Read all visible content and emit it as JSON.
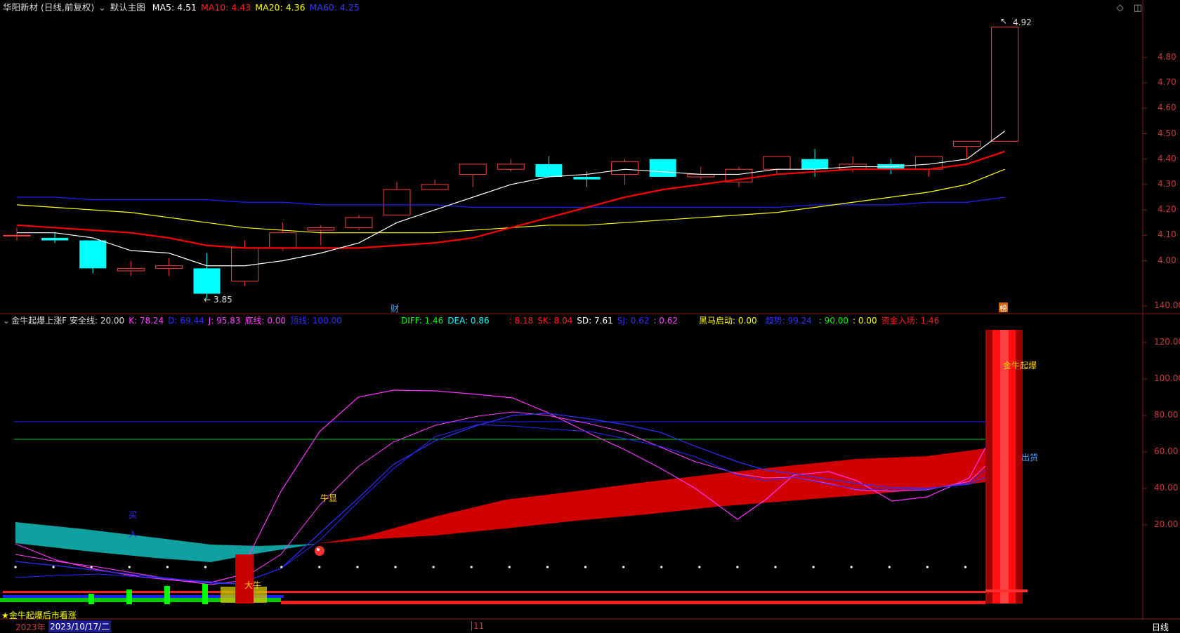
{
  "main_header": {
    "title": "华阳新材 (日线,前复权)",
    "template": "默认主图",
    "ma5": "MA5: 4.51",
    "ma10": "MA10: 4.43",
    "ma20": "MA20: 4.36",
    "ma60": "MA60: 4.25"
  },
  "main_axis": [
    "4.80",
    "4.70",
    "4.60",
    "4.50",
    "4.40",
    "4.30",
    "4.20",
    "4.10",
    "4.00"
  ],
  "main_annotations": {
    "high": "4.92",
    "low": "3.85",
    "cai": "财",
    "badge": "榜"
  },
  "sub_header": {
    "name": "金牛起爆上涨F",
    "safe": "安全线: 20.00",
    "k": "K: 78.24",
    "d": "D: 69.44",
    "j": "J: 95.83",
    "bottom": "底线: 0.00",
    "top": "顶线: 100.00",
    "diff": "DIFF: 1.46",
    "dea": "DEA: 0.86",
    "v1": ": 8.18",
    "sk": "SK: 8.04",
    "sd": "SD: 7.61",
    "sj": "SJ: 0.62",
    "v2": ": 0.62",
    "hm": "黑马启动: 0.00",
    "qs": "趋势: 99.24",
    "v3": ": 90.00",
    "v4": ": 0.00",
    "zj": "资金入场: 1.46"
  },
  "sub_axis": [
    "140.00",
    "120.00",
    "100.00",
    "80.00",
    "60.00",
    "40.00",
    "20.00"
  ],
  "sub_annotations": {
    "jinniu": "金牛起爆",
    "chuhuo": "出货",
    "niuxian": "牛显",
    "daniu": "大牛",
    "mai": "买",
    "ru": "入"
  },
  "footer": {
    "signal": "★金牛起爆后市看涨",
    "year": "2023年",
    "date": "2023/10/17/二",
    "month": "11",
    "period": "日线"
  },
  "colors": {
    "up": "#ff3c3c",
    "down": "#00ffff",
    "ma5": "#ffffff",
    "ma10": "#ff0000",
    "ma20": "#ffff00",
    "ma60": "#2020ff"
  }
}
